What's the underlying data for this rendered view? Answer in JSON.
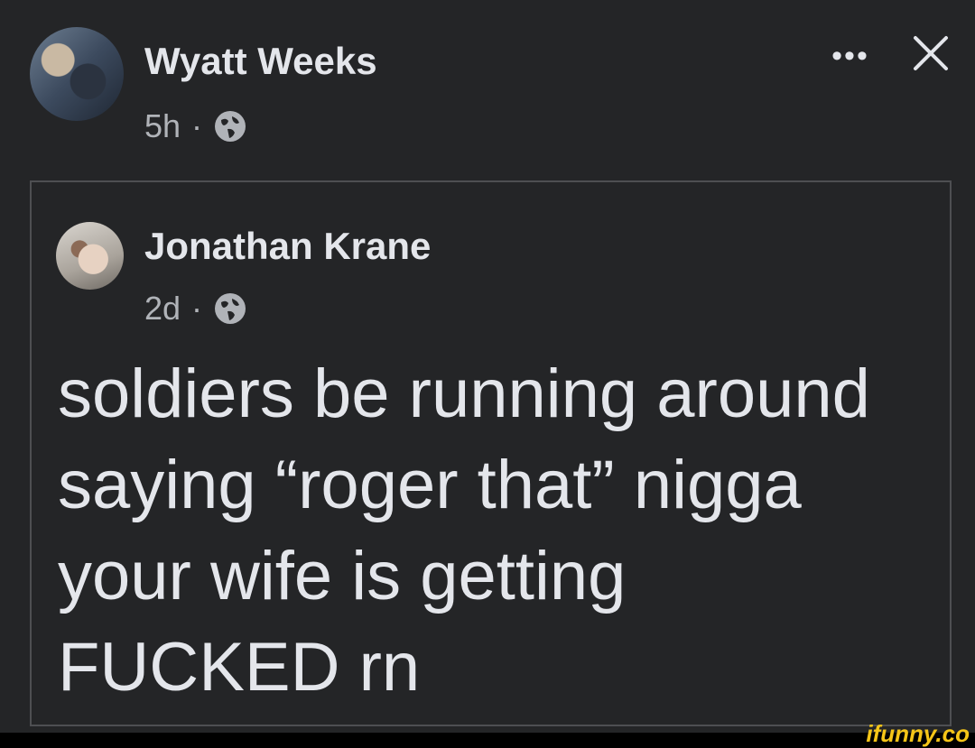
{
  "post": {
    "author": "Wyatt Weeks",
    "time": "5h",
    "separator": "·",
    "privacy_icon": "globe-icon",
    "more_label": "•••",
    "close_icon": "close-icon"
  },
  "shared_post": {
    "author": "Jonathan Krane",
    "time": "2d",
    "separator": "·",
    "privacy_icon": "globe-icon",
    "text": "soldiers be running around\nsaying “roger that” nigga\nyour wife is getting\nFUCKED rn"
  },
  "watermark": "ifunny.co",
  "colors": {
    "background": "#242527",
    "text_primary": "#e4e6eb",
    "text_secondary": "#b0b3b8",
    "border": "#4e4f52",
    "watermark": "#f5c518"
  }
}
